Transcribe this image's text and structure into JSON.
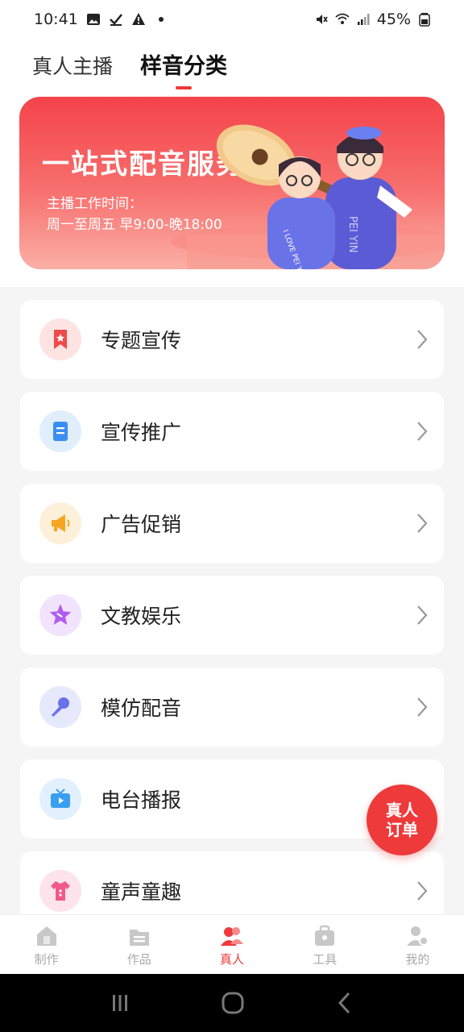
{
  "status_bar": {
    "time": "10:41",
    "battery": "45%"
  },
  "tabs": [
    {
      "label": "真人主播",
      "active": false
    },
    {
      "label": "样音分类",
      "active": true
    }
  ],
  "banner": {
    "title": "一站式配音服务",
    "subtitle_line1": "主播工作时间：",
    "subtitle_line2": "周一至周五 早9:00-晚18:00",
    "art_text_1": "PEI YIN",
    "art_text_2": "I LOVE PEI YIN"
  },
  "categories": [
    {
      "label": "专题宣传",
      "icon": "bookmark-star-icon",
      "color": "#f04a4a",
      "bg": "#fde3e1"
    },
    {
      "label": "宣传推广",
      "icon": "document-icon",
      "color": "#3a8ef0",
      "bg": "#e1eefc"
    },
    {
      "label": "广告促销",
      "icon": "megaphone-icon",
      "color": "#f5a623",
      "bg": "#fdf0da"
    },
    {
      "label": "文教娱乐",
      "icon": "star-icon",
      "color": "#b05cf0",
      "bg": "#f2e3fd"
    },
    {
      "label": "模仿配音",
      "icon": "microphone-icon",
      "color": "#6a72e8",
      "bg": "#e6e8fb"
    },
    {
      "label": "电台播报",
      "icon": "tv-icon",
      "color": "#3a9ef0",
      "bg": "#e1f0fc"
    },
    {
      "label": "童声童趣",
      "icon": "baby-clothes-icon",
      "color": "#f05a8a",
      "bg": "#fde3ec"
    }
  ],
  "fab": {
    "line1": "真人",
    "line2": "订单"
  },
  "bottom_nav": [
    {
      "label": "制作",
      "icon": "make-icon",
      "active": false
    },
    {
      "label": "作品",
      "icon": "works-icon",
      "active": false
    },
    {
      "label": "真人",
      "icon": "people-icon",
      "active": true
    },
    {
      "label": "工具",
      "icon": "toolbox-icon",
      "active": false
    },
    {
      "label": "我的",
      "icon": "profile-icon",
      "active": false
    }
  ],
  "colors": {
    "accent": "#ee3a3a",
    "background": "#f5f5f5"
  }
}
